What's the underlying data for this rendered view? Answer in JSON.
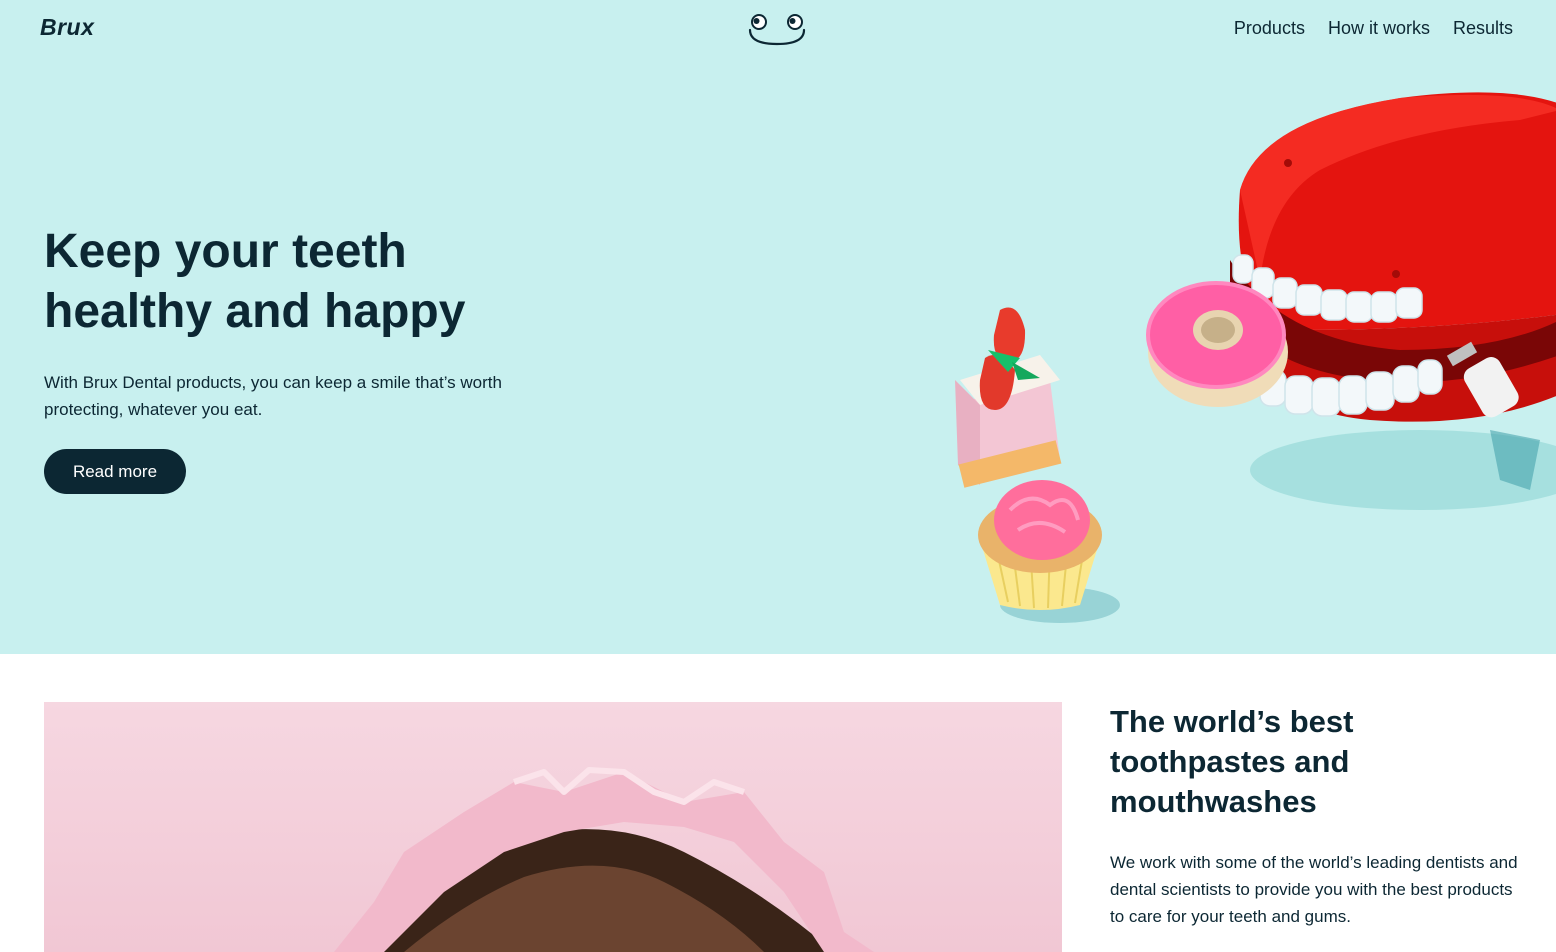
{
  "header": {
    "brand": "Brux",
    "logo_icon": "smiley-face-icon",
    "nav": [
      "Products",
      "How it works",
      "Results"
    ]
  },
  "hero": {
    "title": "Keep your teeth healthy and happy",
    "description": "With Brux Dental products, you can keep a smile that’s worth protecting, whatever you eat.",
    "cta_label": "Read more",
    "background_color": "#c8f0ef",
    "accent_color": "#0c2733"
  },
  "feature": {
    "title": "The world’s best toothpastes and mouthwashes",
    "description": "We work with some of the world’s leading dentists and dental scientists to provide you with the best products to care for your teeth and gums.",
    "image_background": "#f4d3de"
  }
}
